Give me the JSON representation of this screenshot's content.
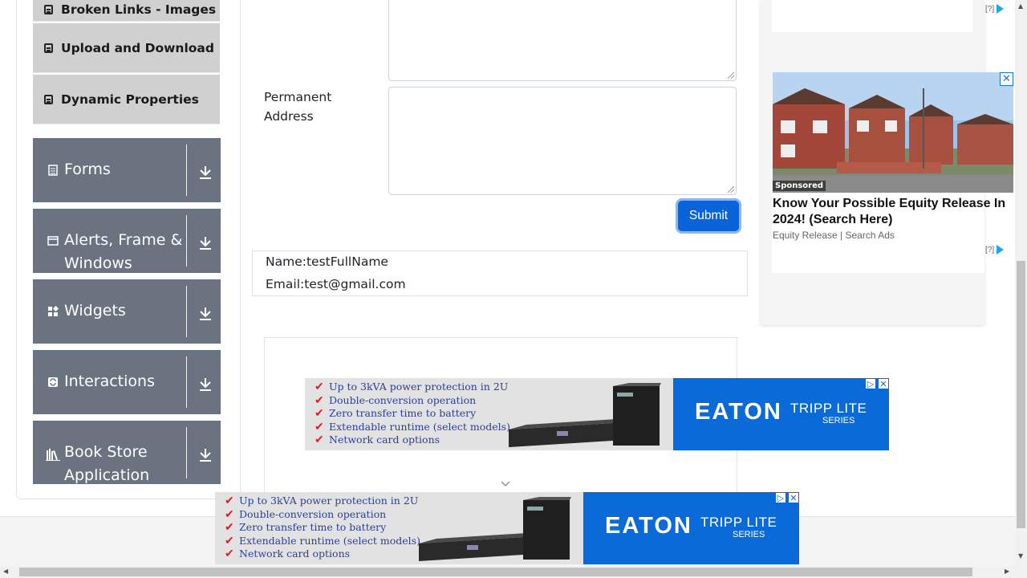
{
  "sidebar": {
    "sub_items": [
      {
        "label": "Broken Links - Images"
      },
      {
        "label": "Upload and Download"
      },
      {
        "label": "Dynamic Properties"
      }
    ],
    "groups": [
      {
        "label_line1": "Forms",
        "label_line2": "",
        "icon": "form-icon"
      },
      {
        "label_line1": "Alerts, Frame &",
        "label_line2": "Windows",
        "icon": "window-icon"
      },
      {
        "label_line1": "Widgets",
        "label_line2": "",
        "icon": "widgets-icon"
      },
      {
        "label_line1": "Interactions",
        "label_line2": "",
        "icon": "interactions-icon"
      },
      {
        "label_line1": "Book Store",
        "label_line2": "Application",
        "icon": "bookstore-icon"
      }
    ]
  },
  "form": {
    "permanent_address_label_line1": "Permanent",
    "permanent_address_label_line2": "Address",
    "submit_label": "Submit"
  },
  "output": {
    "name": "Name:testFullName",
    "email": "Email:test@gmail.com"
  },
  "eaton_ad": {
    "bullets": [
      "Up to 3kVA power protection in 2U",
      "Double-conversion operation",
      "Zero transfer time to battery",
      "Extendable runtime (select models)",
      "Network card options"
    ],
    "brand": "EATON",
    "brand_sub": "TRIPP LITE",
    "brand_series": "SERIES",
    "brand_color": "#0a6ad8"
  },
  "right_ad": {
    "adchoices_top": "[?]",
    "sponsored": "Sponsored",
    "title": "Know Your Possible Equity Release In 2024! (Search Here)",
    "source": "Equity Release | Search Ads",
    "adchoices_bottom": "[?]"
  }
}
